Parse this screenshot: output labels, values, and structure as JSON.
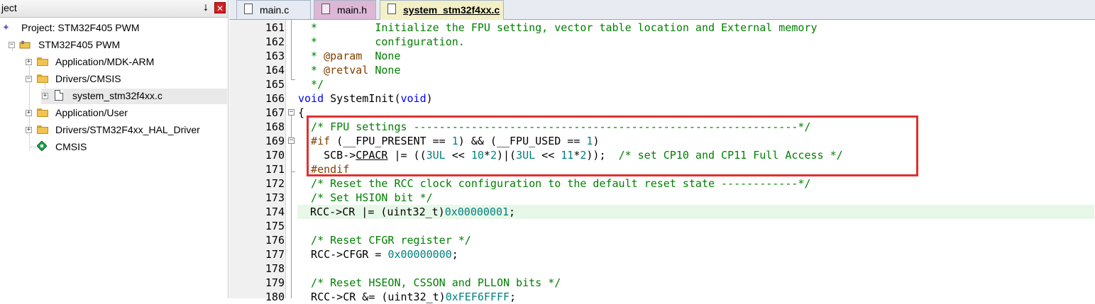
{
  "project_panel": {
    "title": "ject",
    "pin_glyph": "⭣",
    "close_glyph": "✕",
    "tree": {
      "root": "Project: STM32F405 PWM",
      "target": "STM32F405 PWM",
      "groups": [
        {
          "label": "Application/MDK-ARM",
          "expander": "+"
        },
        {
          "label": "Drivers/CMSIS",
          "expander": "−"
        },
        {
          "label": "system_stm32f4xx.c",
          "expander": "+"
        },
        {
          "label": "Application/User",
          "expander": "+"
        },
        {
          "label": "Drivers/STM32F4xx_HAL_Driver",
          "expander": "+"
        },
        {
          "label": "CMSIS",
          "expander": ""
        }
      ]
    }
  },
  "tabs": [
    {
      "label": "main.c",
      "active": false
    },
    {
      "label": "main.h",
      "active": false
    },
    {
      "label": "system_stm32f4xx.c",
      "active": true
    }
  ],
  "editor": {
    "current_line": "174",
    "lines": [
      {
        "n": "161",
        "segs": [
          [
            "c-com",
            "  *         Initialize the FPU setting, vector table location and External memory"
          ]
        ]
      },
      {
        "n": "162",
        "segs": [
          [
            "c-com",
            "  *         configuration."
          ]
        ]
      },
      {
        "n": "163",
        "segs": [
          [
            "c-com",
            "  * "
          ],
          [
            "c-pre",
            "@param"
          ],
          [
            "c-com",
            "  None"
          ]
        ]
      },
      {
        "n": "164",
        "segs": [
          [
            "c-com",
            "  * "
          ],
          [
            "c-pre",
            "@retval"
          ],
          [
            "c-com",
            " None"
          ]
        ]
      },
      {
        "n": "165",
        "segs": [
          [
            "c-com",
            "  */"
          ]
        ]
      },
      {
        "n": "166",
        "segs": [
          [
            "c-kw",
            "void"
          ],
          [
            "",
            " SystemInit("
          ],
          [
            "c-kw",
            "void"
          ],
          [
            "",
            ")"
          ]
        ]
      },
      {
        "n": "167",
        "segs": [
          [
            "",
            "{"
          ]
        ]
      },
      {
        "n": "168",
        "segs": [
          [
            "c-com",
            "  /* FPU settings ------------------------------------------------------------*/"
          ]
        ]
      },
      {
        "n": "169",
        "segs": [
          [
            "c-pre",
            "  #if"
          ],
          [
            "",
            " (__FPU_PRESENT == "
          ],
          [
            "c-num",
            "1"
          ],
          [
            "",
            ") && (__FPU_USED == "
          ],
          [
            "c-num",
            "1"
          ],
          [
            "",
            ")"
          ]
        ]
      },
      {
        "n": "170",
        "segs": [
          [
            "",
            "    SCB->"
          ],
          [
            "c-und",
            "CPACR"
          ],
          [
            "",
            " |= (("
          ],
          [
            "c-num",
            "3UL"
          ],
          [
            "",
            " << "
          ],
          [
            "c-num",
            "10"
          ],
          [
            "",
            "*"
          ],
          [
            "c-num",
            "2"
          ],
          [
            "",
            ")|("
          ],
          [
            "c-num",
            "3UL"
          ],
          [
            "",
            " << "
          ],
          [
            "c-num",
            "11"
          ],
          [
            "",
            "*"
          ],
          [
            "c-num",
            "2"
          ],
          [
            "",
            "));  "
          ],
          [
            "c-com",
            "/* set CP10 and CP11 Full Access */"
          ]
        ]
      },
      {
        "n": "171",
        "segs": [
          [
            "c-pre",
            "  #endif"
          ]
        ]
      },
      {
        "n": "172",
        "segs": [
          [
            "c-com",
            "  /* Reset the RCC clock configuration to the default reset state ------------*/"
          ]
        ]
      },
      {
        "n": "173",
        "segs": [
          [
            "c-com",
            "  /* Set HSION bit */"
          ]
        ]
      },
      {
        "n": "174",
        "segs": [
          [
            "",
            "  RCC->CR |= (uint32_t)"
          ],
          [
            "c-num",
            "0x00000001"
          ],
          [
            "",
            ";"
          ]
        ]
      },
      {
        "n": "175",
        "segs": [
          [
            "",
            ""
          ]
        ]
      },
      {
        "n": "176",
        "segs": [
          [
            "c-com",
            "  /* Reset CFGR register */"
          ]
        ]
      },
      {
        "n": "177",
        "segs": [
          [
            "",
            "  RCC->CFGR = "
          ],
          [
            "c-num",
            "0x00000000"
          ],
          [
            "",
            ";"
          ]
        ]
      },
      {
        "n": "178",
        "segs": [
          [
            "",
            ""
          ]
        ]
      },
      {
        "n": "179",
        "segs": [
          [
            "c-com",
            "  /* Reset HSEON, CSSON and PLLON bits */"
          ]
        ]
      },
      {
        "n": "180",
        "segs": [
          [
            "",
            "  RCC->CR &= (uint32_t)"
          ],
          [
            "c-num",
            "0xFEF6FFFF"
          ],
          [
            "",
            ";"
          ]
        ]
      }
    ]
  },
  "colors": {
    "highlight_box": "#e03030",
    "current_line_bg": "#e8f8e8",
    "comment": "#008000",
    "keyword": "#0000ff",
    "number": "#008080"
  }
}
